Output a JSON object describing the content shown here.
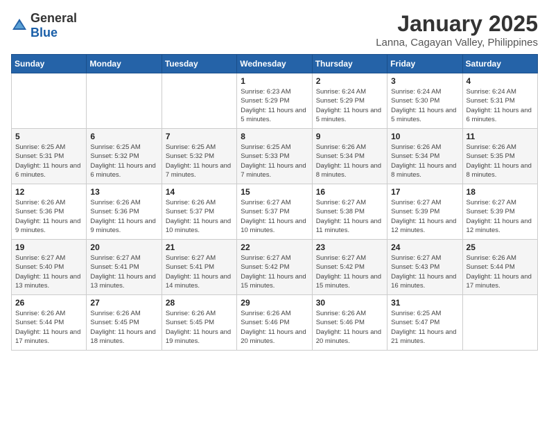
{
  "header": {
    "logo_general": "General",
    "logo_blue": "Blue",
    "month": "January 2025",
    "location": "Lanna, Cagayan Valley, Philippines"
  },
  "weekdays": [
    "Sunday",
    "Monday",
    "Tuesday",
    "Wednesday",
    "Thursday",
    "Friday",
    "Saturday"
  ],
  "weeks": [
    [
      {
        "day": "",
        "sunrise": "",
        "sunset": "",
        "daylight": ""
      },
      {
        "day": "",
        "sunrise": "",
        "sunset": "",
        "daylight": ""
      },
      {
        "day": "",
        "sunrise": "",
        "sunset": "",
        "daylight": ""
      },
      {
        "day": "1",
        "sunrise": "Sunrise: 6:23 AM",
        "sunset": "Sunset: 5:29 PM",
        "daylight": "Daylight: 11 hours and 5 minutes."
      },
      {
        "day": "2",
        "sunrise": "Sunrise: 6:24 AM",
        "sunset": "Sunset: 5:29 PM",
        "daylight": "Daylight: 11 hours and 5 minutes."
      },
      {
        "day": "3",
        "sunrise": "Sunrise: 6:24 AM",
        "sunset": "Sunset: 5:30 PM",
        "daylight": "Daylight: 11 hours and 5 minutes."
      },
      {
        "day": "4",
        "sunrise": "Sunrise: 6:24 AM",
        "sunset": "Sunset: 5:31 PM",
        "daylight": "Daylight: 11 hours and 6 minutes."
      }
    ],
    [
      {
        "day": "5",
        "sunrise": "Sunrise: 6:25 AM",
        "sunset": "Sunset: 5:31 PM",
        "daylight": "Daylight: 11 hours and 6 minutes."
      },
      {
        "day": "6",
        "sunrise": "Sunrise: 6:25 AM",
        "sunset": "Sunset: 5:32 PM",
        "daylight": "Daylight: 11 hours and 6 minutes."
      },
      {
        "day": "7",
        "sunrise": "Sunrise: 6:25 AM",
        "sunset": "Sunset: 5:32 PM",
        "daylight": "Daylight: 11 hours and 7 minutes."
      },
      {
        "day": "8",
        "sunrise": "Sunrise: 6:25 AM",
        "sunset": "Sunset: 5:33 PM",
        "daylight": "Daylight: 11 hours and 7 minutes."
      },
      {
        "day": "9",
        "sunrise": "Sunrise: 6:26 AM",
        "sunset": "Sunset: 5:34 PM",
        "daylight": "Daylight: 11 hours and 8 minutes."
      },
      {
        "day": "10",
        "sunrise": "Sunrise: 6:26 AM",
        "sunset": "Sunset: 5:34 PM",
        "daylight": "Daylight: 11 hours and 8 minutes."
      },
      {
        "day": "11",
        "sunrise": "Sunrise: 6:26 AM",
        "sunset": "Sunset: 5:35 PM",
        "daylight": "Daylight: 11 hours and 8 minutes."
      }
    ],
    [
      {
        "day": "12",
        "sunrise": "Sunrise: 6:26 AM",
        "sunset": "Sunset: 5:36 PM",
        "daylight": "Daylight: 11 hours and 9 minutes."
      },
      {
        "day": "13",
        "sunrise": "Sunrise: 6:26 AM",
        "sunset": "Sunset: 5:36 PM",
        "daylight": "Daylight: 11 hours and 9 minutes."
      },
      {
        "day": "14",
        "sunrise": "Sunrise: 6:26 AM",
        "sunset": "Sunset: 5:37 PM",
        "daylight": "Daylight: 11 hours and 10 minutes."
      },
      {
        "day": "15",
        "sunrise": "Sunrise: 6:27 AM",
        "sunset": "Sunset: 5:37 PM",
        "daylight": "Daylight: 11 hours and 10 minutes."
      },
      {
        "day": "16",
        "sunrise": "Sunrise: 6:27 AM",
        "sunset": "Sunset: 5:38 PM",
        "daylight": "Daylight: 11 hours and 11 minutes."
      },
      {
        "day": "17",
        "sunrise": "Sunrise: 6:27 AM",
        "sunset": "Sunset: 5:39 PM",
        "daylight": "Daylight: 11 hours and 12 minutes."
      },
      {
        "day": "18",
        "sunrise": "Sunrise: 6:27 AM",
        "sunset": "Sunset: 5:39 PM",
        "daylight": "Daylight: 11 hours and 12 minutes."
      }
    ],
    [
      {
        "day": "19",
        "sunrise": "Sunrise: 6:27 AM",
        "sunset": "Sunset: 5:40 PM",
        "daylight": "Daylight: 11 hours and 13 minutes."
      },
      {
        "day": "20",
        "sunrise": "Sunrise: 6:27 AM",
        "sunset": "Sunset: 5:41 PM",
        "daylight": "Daylight: 11 hours and 13 minutes."
      },
      {
        "day": "21",
        "sunrise": "Sunrise: 6:27 AM",
        "sunset": "Sunset: 5:41 PM",
        "daylight": "Daylight: 11 hours and 14 minutes."
      },
      {
        "day": "22",
        "sunrise": "Sunrise: 6:27 AM",
        "sunset": "Sunset: 5:42 PM",
        "daylight": "Daylight: 11 hours and 15 minutes."
      },
      {
        "day": "23",
        "sunrise": "Sunrise: 6:27 AM",
        "sunset": "Sunset: 5:42 PM",
        "daylight": "Daylight: 11 hours and 15 minutes."
      },
      {
        "day": "24",
        "sunrise": "Sunrise: 6:27 AM",
        "sunset": "Sunset: 5:43 PM",
        "daylight": "Daylight: 11 hours and 16 minutes."
      },
      {
        "day": "25",
        "sunrise": "Sunrise: 6:26 AM",
        "sunset": "Sunset: 5:44 PM",
        "daylight": "Daylight: 11 hours and 17 minutes."
      }
    ],
    [
      {
        "day": "26",
        "sunrise": "Sunrise: 6:26 AM",
        "sunset": "Sunset: 5:44 PM",
        "daylight": "Daylight: 11 hours and 17 minutes."
      },
      {
        "day": "27",
        "sunrise": "Sunrise: 6:26 AM",
        "sunset": "Sunset: 5:45 PM",
        "daylight": "Daylight: 11 hours and 18 minutes."
      },
      {
        "day": "28",
        "sunrise": "Sunrise: 6:26 AM",
        "sunset": "Sunset: 5:45 PM",
        "daylight": "Daylight: 11 hours and 19 minutes."
      },
      {
        "day": "29",
        "sunrise": "Sunrise: 6:26 AM",
        "sunset": "Sunset: 5:46 PM",
        "daylight": "Daylight: 11 hours and 20 minutes."
      },
      {
        "day": "30",
        "sunrise": "Sunrise: 6:26 AM",
        "sunset": "Sunset: 5:46 PM",
        "daylight": "Daylight: 11 hours and 20 minutes."
      },
      {
        "day": "31",
        "sunrise": "Sunrise: 6:25 AM",
        "sunset": "Sunset: 5:47 PM",
        "daylight": "Daylight: 11 hours and 21 minutes."
      },
      {
        "day": "",
        "sunrise": "",
        "sunset": "",
        "daylight": ""
      }
    ]
  ]
}
